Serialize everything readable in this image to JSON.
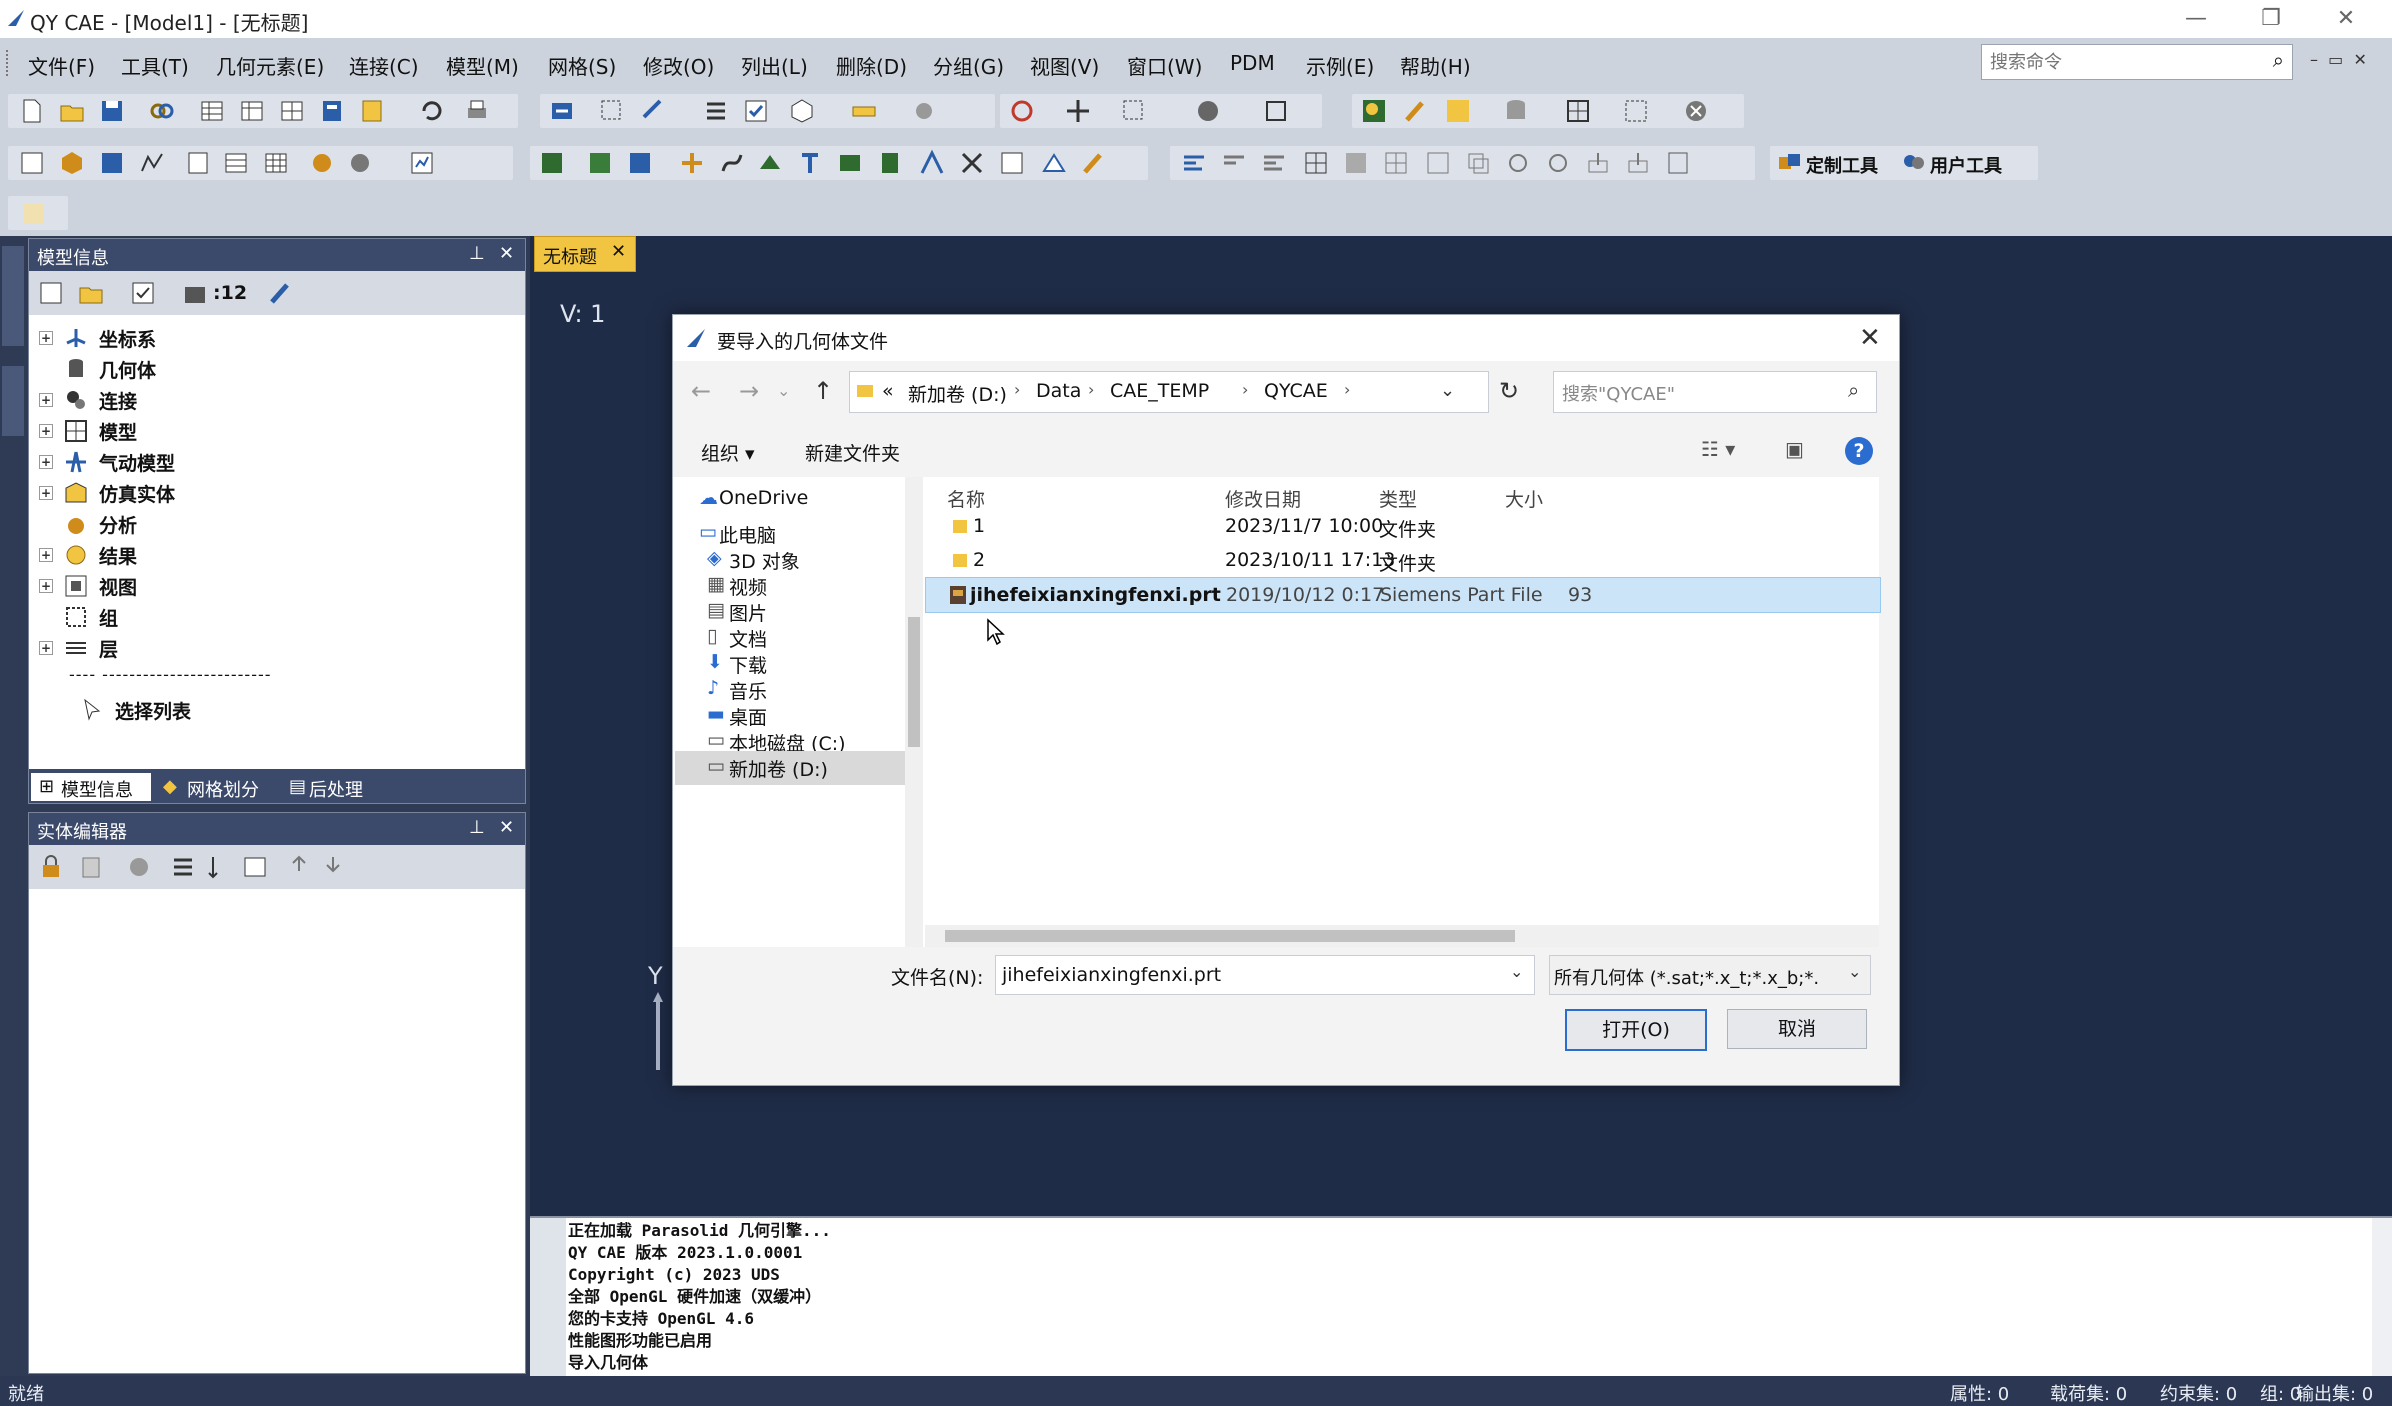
{
  "app": {
    "title": "QY CAE - [Model1] - [无标题]",
    "menus": [
      "文件(F)",
      "工具(T)",
      "几何元素(E)",
      "连接(C)",
      "模型(M)",
      "网格(S)",
      "修改(O)",
      "列出(L)",
      "删除(D)",
      "分组(G)",
      "视图(V)",
      "窗口(W)",
      "PDM",
      "示例(E)",
      "帮助(H)"
    ],
    "command_search_placeholder": "搜索命令",
    "custom_tools": "定制工具",
    "user_tools": "用户工具",
    "toolbar_counter": ":12"
  },
  "document_tab": "无标题",
  "viewport": {
    "label": "V: 1",
    "axis_y": "Y"
  },
  "model_panel": {
    "title": "模型信息",
    "tree": [
      "坐标系",
      "几何体",
      "连接",
      "模型",
      "气动模型",
      "仿真实体",
      "分析",
      "结果",
      "视图",
      "组",
      "层"
    ],
    "separator": "---- -------------------------",
    "select_list": "选择列表",
    "tabs": [
      "模型信息",
      "网格划分",
      "后处理"
    ]
  },
  "entity_panel": {
    "title": "实体编辑器"
  },
  "console": {
    "lines": [
      "正在加载 Parasolid 几何引擎...",
      "QY CAE 版本 2023.1.0.0001",
      "Copyright (c) 2023 UDS",
      "全部 OpenGL 硬件加速（双缓冲）",
      "您的卡支持 OpenGL 4.6",
      "性能图形功能已启用",
      "导入几何体"
    ]
  },
  "statusbar": {
    "left": "就绪",
    "counts": [
      "属性: 0",
      "载荷集: 0",
      "约束集: 0",
      "组: 0",
      "输出集: 0"
    ]
  },
  "dialog": {
    "title": "要导入的几何体文件",
    "breadcrumb": [
      "«",
      "新加卷 (D:)",
      "Data",
      "CAE_TEMP",
      "QYCAE"
    ],
    "search_placeholder": "搜索\"QYCAE\"",
    "organize": "组织 ▾",
    "new_folder": "新建文件夹",
    "nav": [
      "OneDrive",
      "此电脑",
      "3D 对象",
      "视频",
      "图片",
      "文档",
      "下载",
      "音乐",
      "桌面",
      "本地磁盘 (C:)",
      "新加卷 (D:)"
    ],
    "columns": [
      "名称",
      "修改日期",
      "类型",
      "大小"
    ],
    "files": [
      {
        "name": "1",
        "date": "2023/11/7 10:00",
        "type": "文件夹",
        "size": ""
      },
      {
        "name": "2",
        "date": "2023/10/11 17:13",
        "type": "文件夹",
        "size": ""
      },
      {
        "name": "jihefeixianxingfenxi.prt",
        "date": "2019/10/12 0:17",
        "type": "Siemens Part File",
        "size": "93"
      }
    ],
    "filename_label": "文件名(N):",
    "filename_value": "jihefeixianxingfenxi.prt",
    "filter_value": "所有几何体 (*.sat;*.x_t;*.x_b;*.",
    "open_button": "打开(O)",
    "cancel_button": "取消"
  },
  "colors": {
    "accent": "#f1c542",
    "panel_header": "#3b4a6b",
    "selection": "#cce4f7"
  }
}
